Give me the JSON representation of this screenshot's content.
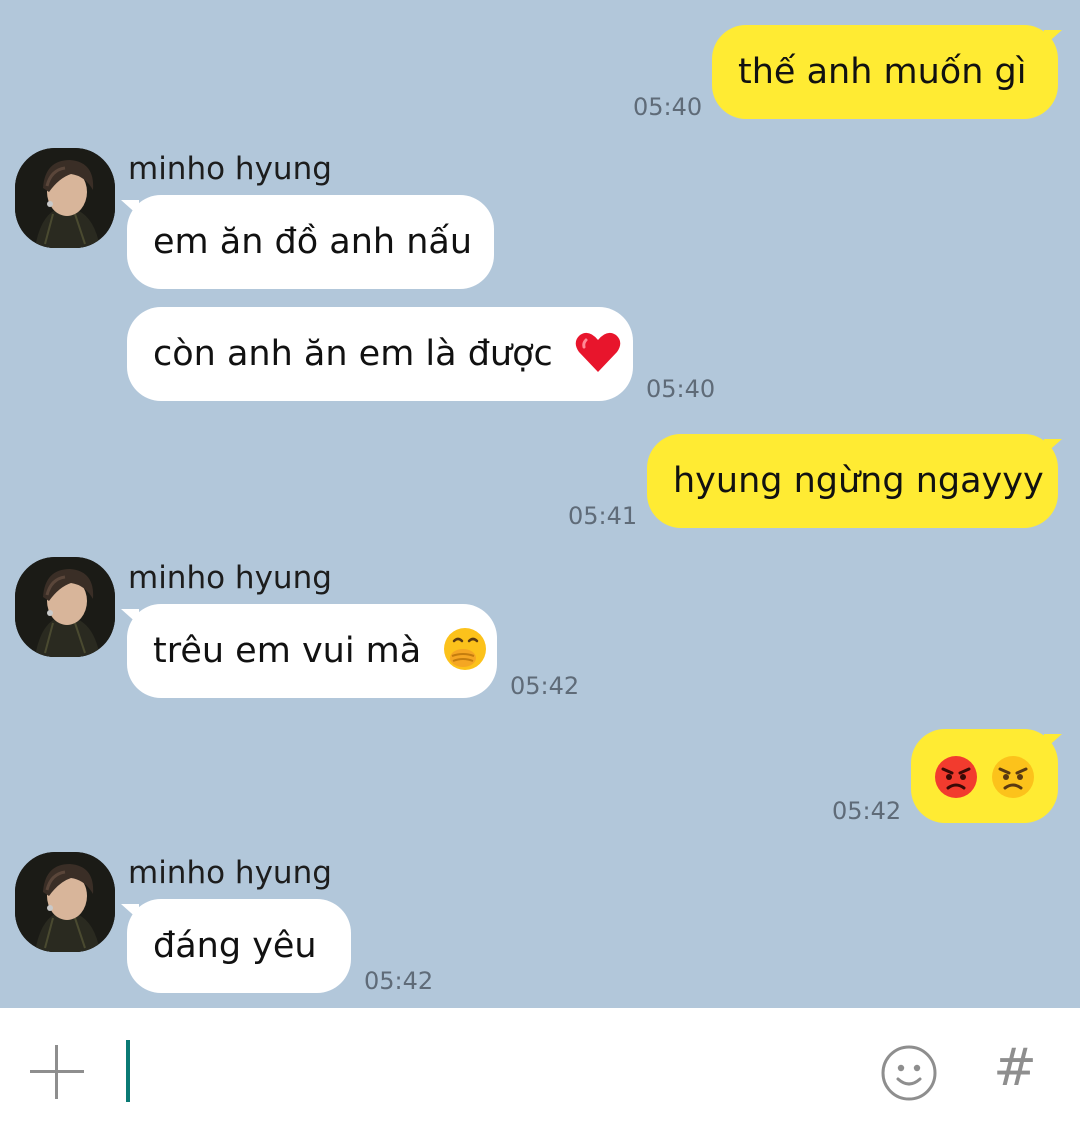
{
  "contact": {
    "name": "minho hyung"
  },
  "messages": [
    {
      "from": "me",
      "text": "thế anh muốn gì",
      "time": "05:40"
    },
    {
      "from": "them",
      "text": "em ăn đồ anh nấu"
    },
    {
      "from": "them",
      "text": "còn anh ăn em là được",
      "emoji": "red-heart",
      "time": "05:40"
    },
    {
      "from": "me",
      "text": "hyung ngừng ngayyy",
      "time": "05:41"
    },
    {
      "from": "them",
      "text": "trêu em vui mà",
      "emoji": "face-with-hand-over-mouth",
      "time": "05:42"
    },
    {
      "from": "me",
      "text": "",
      "emojis": [
        "pouting-face",
        "angry-face"
      ],
      "time": "05:42"
    },
    {
      "from": "them",
      "text": "đáng yêu",
      "time": "05:42"
    }
  ],
  "input_bar": {
    "value": "",
    "icons": [
      "plus-icon",
      "emoji-icon",
      "hashtag-icon"
    ],
    "hash_symbol": "#"
  },
  "colors": {
    "background": "#b2c7da",
    "my_bubble": "#ffeb33",
    "their_bubble": "#ffffff",
    "timestamp": "#5f6b78",
    "caret": "#0a7a74"
  }
}
